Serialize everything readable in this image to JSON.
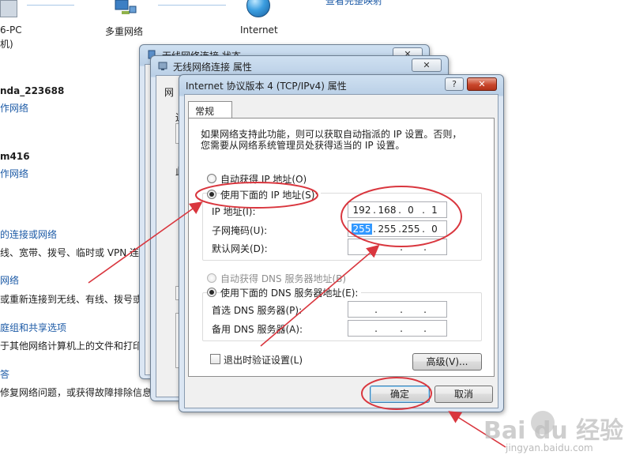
{
  "background": {
    "network_map": {
      "pc_label": "6-PC",
      "pc_sub": "机)",
      "multi_network": "多重网络",
      "internet": "Internet",
      "top_link": "查看完整映射"
    },
    "networks": [
      {
        "name": "nda_223688",
        "type": "作网络"
      },
      {
        "name": "m416",
        "type": "作网络"
      }
    ],
    "tasks": [
      {
        "title": "的连接或网络",
        "desc": "线、宽带、拨号、临时或 VPN 连"
      },
      {
        "title": "网络",
        "desc": "或重新连接到无线、有线、拨号或"
      },
      {
        "title": "庭组和共享选项",
        "desc": "于其他网络计算机上的文件和打印"
      },
      {
        "title": "答",
        "desc": "修复网络问题，或获得故障排除信息。"
      }
    ]
  },
  "win_status": {
    "title": "无线网络连接 状态"
  },
  "win_props": {
    "title": "无线网络连接 属性",
    "left_labels": [
      "网",
      "连",
      "此"
    ]
  },
  "dialog": {
    "title": "Internet 协议版本 4 (TCP/IPv4) 属性",
    "help": "?",
    "close": "✕",
    "tab": "常规",
    "intro_line1": "如果网络支持此功能，则可以获取自动指派的 IP 设置。否则，",
    "intro_line2": "您需要从网络系统管理员处获得适当的 IP 设置。",
    "auto_ip": "自动获得 IP 地址(O)",
    "manual_ip": "使用下面的 IP 地址(S):",
    "ip_label": "IP 地址(I):",
    "mask_label": "子网掩码(U):",
    "gateway_label": "默认网关(D):",
    "ip_octets": [
      "192",
      "168",
      "0",
      "1"
    ],
    "mask_octets": [
      "255",
      "255",
      "255",
      "0"
    ],
    "dot": ".",
    "auto_dns": "自动获得 DNS 服务器地址(B)",
    "manual_dns": "使用下面的 DNS 服务器地址(E):",
    "pref_dns": "首选 DNS 服务器(P):",
    "alt_dns": "备用 DNS 服务器(A):",
    "validate": "退出时验证设置(L)",
    "advanced": "高级(V)...",
    "ok": "确定",
    "cancel": "取消"
  },
  "watermark": {
    "main": "Bai du 经验",
    "sub": "jingyan.baidu.com"
  },
  "colors": {
    "annotation": "#d9363e",
    "link": "#1c5aa6"
  }
}
